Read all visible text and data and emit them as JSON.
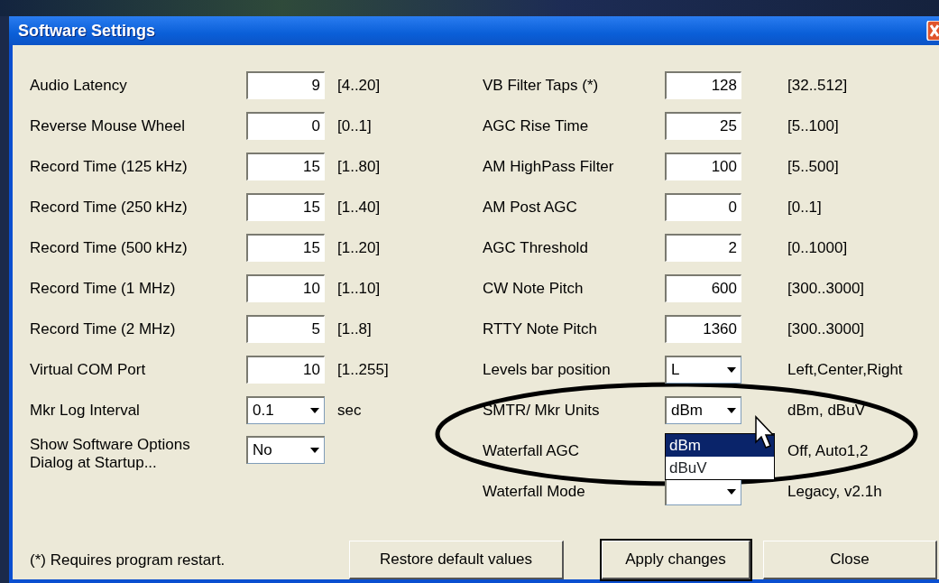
{
  "window": {
    "title": "Software Settings"
  },
  "left_settings": [
    {
      "label": "Audio Latency",
      "kind": "text",
      "value": "9",
      "hint": "[4..20]"
    },
    {
      "label": "Reverse Mouse Wheel",
      "kind": "text",
      "value": "0",
      "hint": "[0..1]"
    },
    {
      "label": "Record Time (125 kHz)",
      "kind": "text",
      "value": "15",
      "hint": "[1..80]"
    },
    {
      "label": "Record Time (250 kHz)",
      "kind": "text",
      "value": "15",
      "hint": "[1..40]"
    },
    {
      "label": "Record Time (500 kHz)",
      "kind": "text",
      "value": "15",
      "hint": "[1..20]"
    },
    {
      "label": "Record Time (1 MHz)",
      "kind": "text",
      "value": "10",
      "hint": "[1..10]"
    },
    {
      "label": "Record Time (2 MHz)",
      "kind": "text",
      "value": "5",
      "hint": "[1..8]"
    },
    {
      "label": "Virtual COM Port",
      "kind": "text",
      "value": "10",
      "hint": "[1..255]"
    },
    {
      "label": "Mkr Log Interval",
      "kind": "combo",
      "value": "0.1",
      "hint": "sec"
    },
    {
      "label": "Show Software Options Dialog at Startup...",
      "kind": "combo",
      "value": "No"
    }
  ],
  "right_settings": [
    {
      "label": "VB Filter Taps (*)",
      "kind": "text",
      "value": "128",
      "hint": "[32..512]"
    },
    {
      "label": "AGC Rise Time",
      "kind": "text",
      "value": "25",
      "hint": "[5..100]"
    },
    {
      "label": "AM HighPass Filter",
      "kind": "text",
      "value": "100",
      "hint": "[5..500]"
    },
    {
      "label": "AM Post AGC",
      "kind": "text",
      "value": "0",
      "hint": "[0..1]"
    },
    {
      "label": "AGC Threshold",
      "kind": "text",
      "value": "2",
      "hint": "[0..1000]"
    },
    {
      "label": "CW Note Pitch",
      "kind": "text",
      "value": "600",
      "hint": "[300..3000]"
    },
    {
      "label": "RTTY Note Pitch",
      "kind": "text",
      "value": "1360",
      "hint": "[300..3000]"
    },
    {
      "label": "Levels bar position",
      "kind": "combo",
      "value": "L",
      "hint": "Left,Center,Right"
    },
    {
      "label": "SMTR/ Mkr Units",
      "kind": "combo",
      "value": "dBm",
      "hint": "dBm, dBuV",
      "open_options": [
        {
          "label": "dBm",
          "selected": true
        },
        {
          "label": "dBuV",
          "selected": false
        }
      ]
    },
    {
      "label": "Waterfall AGC",
      "kind": "covered",
      "hint": "Off, Auto1,2"
    },
    {
      "label": "Waterfall Mode",
      "kind": "combo",
      "hint": "Legacy, v2.1h"
    }
  ],
  "footnote": "(*) Requires program restart.",
  "buttons": [
    {
      "label": "Restore default values",
      "default": false
    },
    {
      "label": "Apply changes",
      "default": true
    },
    {
      "label": "Close",
      "default": false
    }
  ]
}
